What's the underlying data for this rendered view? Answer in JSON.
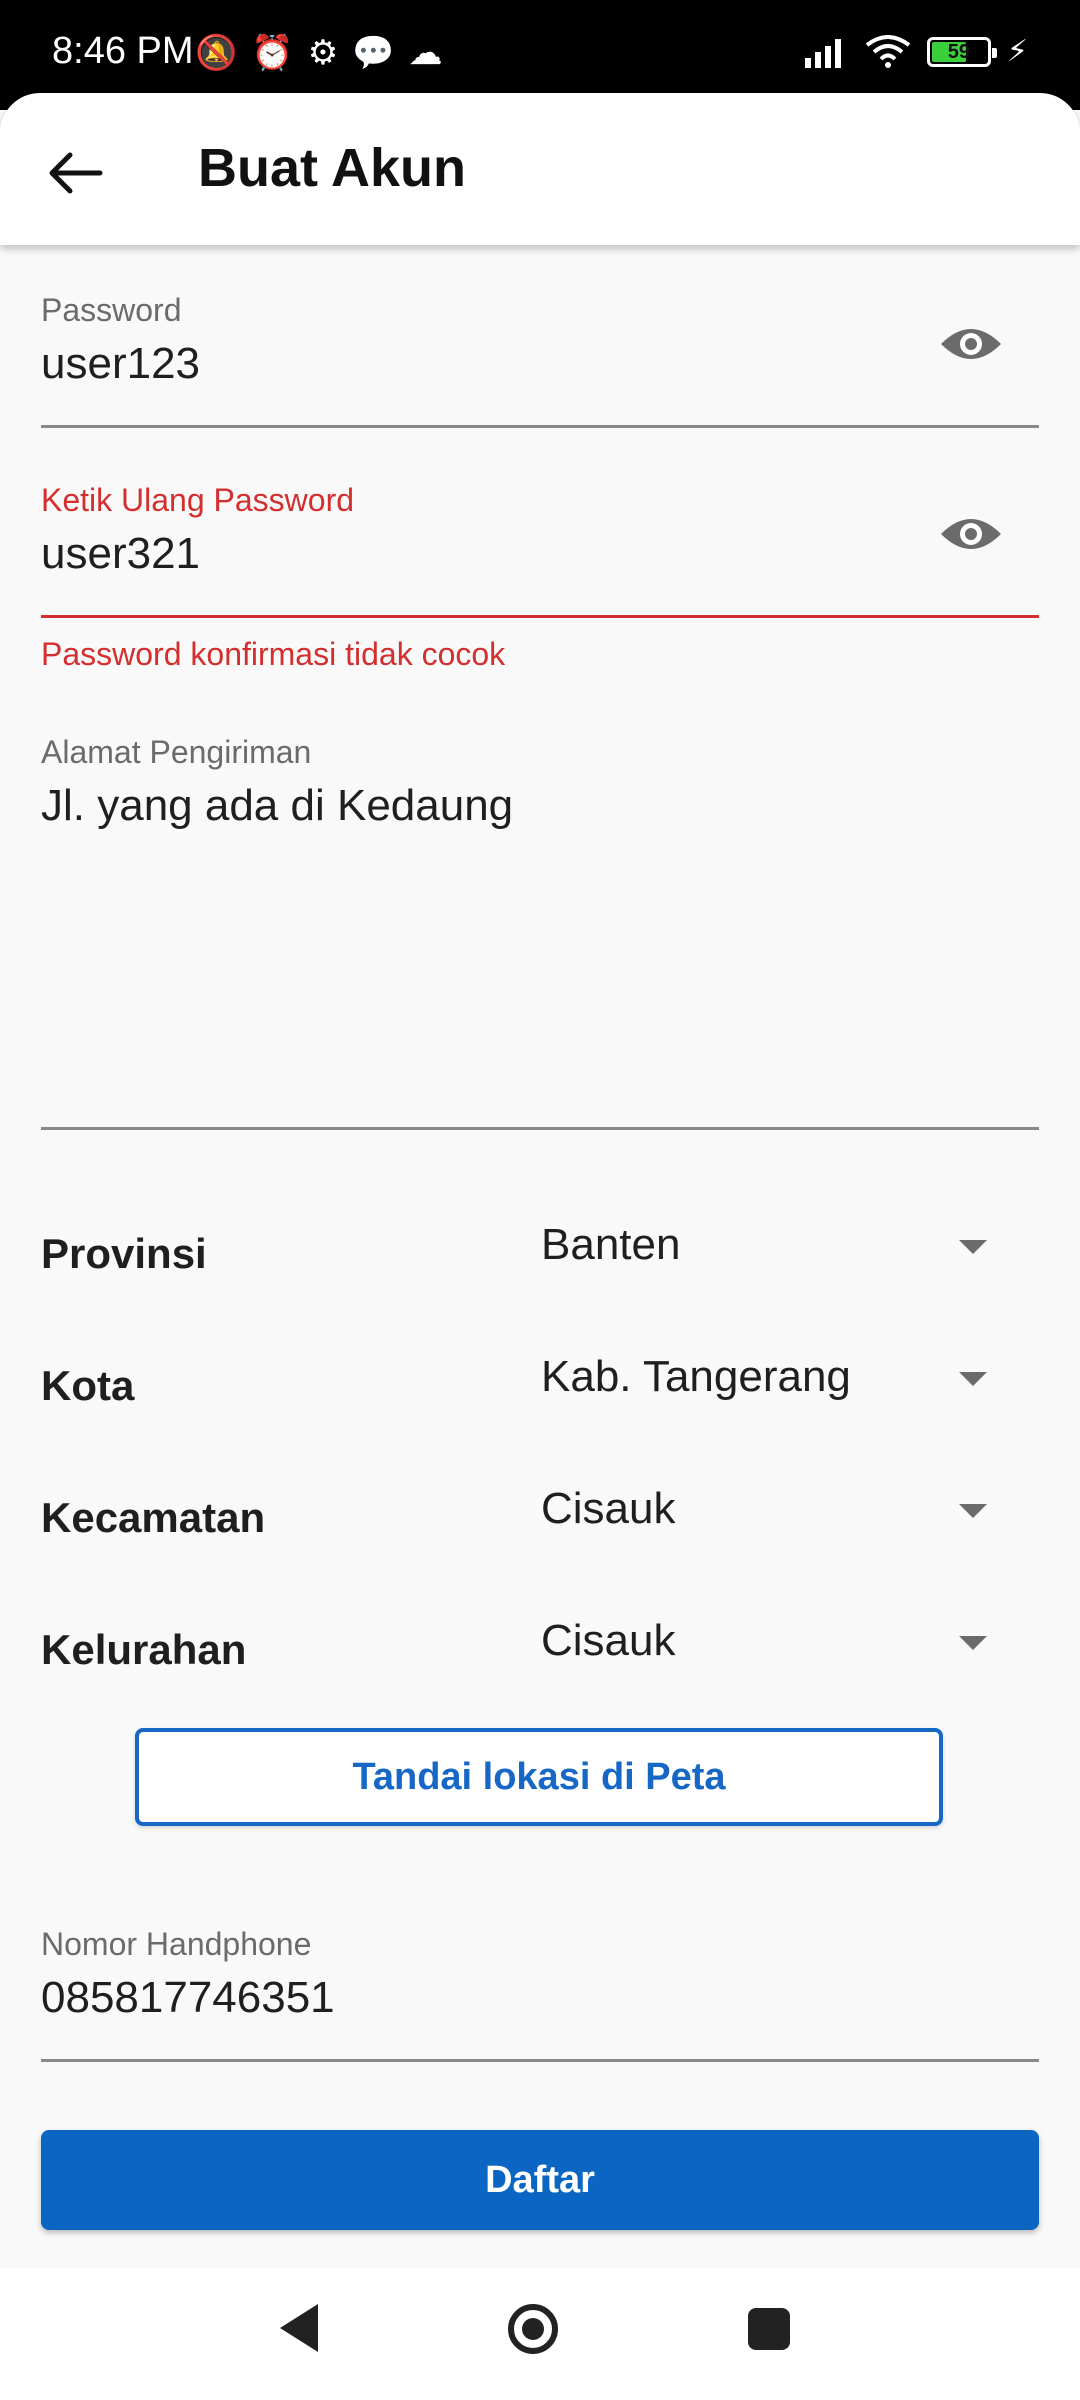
{
  "status_bar": {
    "time": "8:46 PM",
    "battery": "59"
  },
  "app_bar": {
    "title": "Buat Akun"
  },
  "form": {
    "password": {
      "label": "Password",
      "value": "user123"
    },
    "confirm_password": {
      "label": "Ketik Ulang Password",
      "value": "user321",
      "error": "Password konfirmasi tidak cocok"
    },
    "address": {
      "label": "Alamat Pengiriman",
      "value": "Jl. yang ada di Kedaung"
    },
    "dropdowns": [
      {
        "label": "Provinsi",
        "value": "Banten"
      },
      {
        "label": "Kota",
        "value": "Kab. Tangerang"
      },
      {
        "label": "Kecamatan",
        "value": "Cisauk"
      },
      {
        "label": "Kelurahan",
        "value": "Cisauk"
      }
    ],
    "map_button": "Tandai lokasi di Peta",
    "phone": {
      "label": "Nomor Handphone",
      "value": "085817746351"
    },
    "submit_button": "Daftar"
  },
  "colors": {
    "accent": "#0b66c3",
    "error": "#d32f2f"
  },
  "icons": [
    "back-arrow-icon",
    "eye-icon",
    "dropdown-arrow-icon",
    "nav-back-icon",
    "nav-home-icon",
    "nav-recents-icon"
  ]
}
